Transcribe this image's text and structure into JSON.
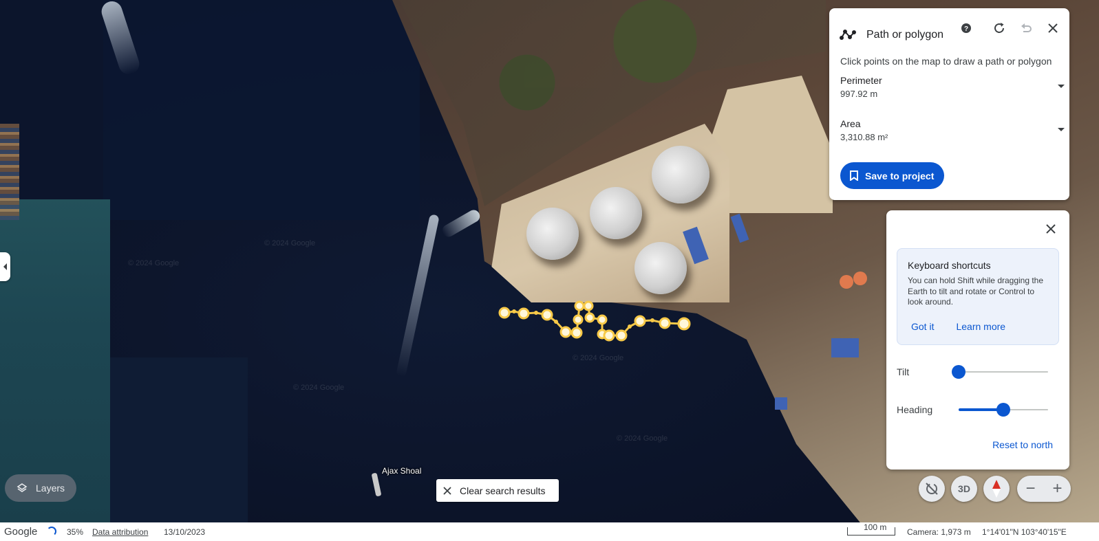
{
  "map": {
    "watermark": "© 2024 Google",
    "label_ajax_shoal": "Ajax Shoal"
  },
  "path_panel": {
    "title": "Path or polygon",
    "hint": "Click points on the map to draw a path or polygon",
    "perimeter_label": "Perimeter",
    "perimeter_value": "997.92 m",
    "area_label": "Area",
    "area_value": "3,310.88 m²",
    "save_label": "Save to project",
    "icons": [
      "path-icon",
      "help-icon",
      "refresh-icon",
      "undo-icon",
      "close-icon"
    ]
  },
  "controls_panel": {
    "kb_title": "Keyboard shortcuts",
    "kb_text": "You can hold Shift while dragging the Earth to tilt and rotate or Control to look around.",
    "got_it": "Got it",
    "learn_more": "Learn more",
    "tilt_label": "Tilt",
    "tilt_value": 0.0,
    "heading_label": "Heading",
    "heading_value": 0.5,
    "reset_label": "Reset to north"
  },
  "map_controls": {
    "btn_3d": "3D",
    "zoom_out": "−",
    "zoom_in": "+"
  },
  "layers_label": "Layers",
  "clear_search_label": "Clear search results",
  "status_bar": {
    "brand": "Google",
    "progress": "35%",
    "data_attribution": "Data attribution",
    "date": "13/10/2023",
    "scale": "100 m",
    "camera": "Camera: 1,973 m",
    "coords": "1°14'01\"N 103°40'15\"E"
  },
  "colors": {
    "accent": "#0b57d0",
    "path_marker": "#f7c948"
  }
}
